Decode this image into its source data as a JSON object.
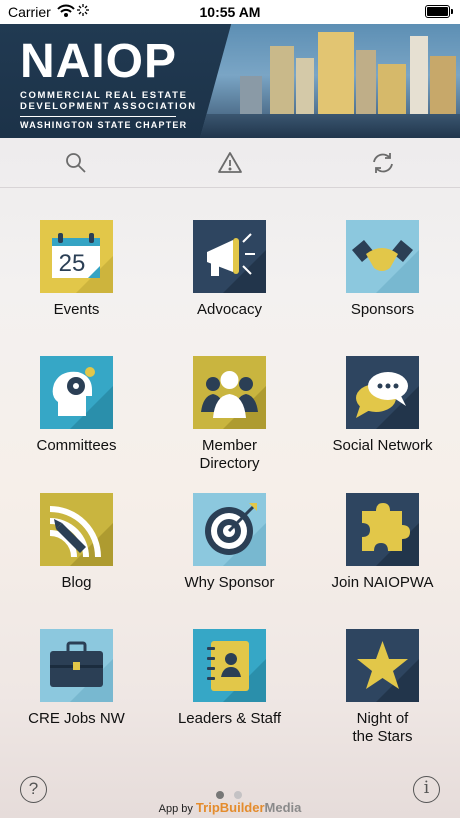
{
  "status": {
    "carrier": "Carrier",
    "time": "10:55 AM"
  },
  "header": {
    "logo_text": "NAIOP",
    "logo_sub_line1": "COMMERCIAL REAL ESTATE",
    "logo_sub_line2": "DEVELOPMENT ASSOCIATION",
    "logo_chapter": "WASHINGTON STATE CHAPTER"
  },
  "toolbar": {
    "icons": [
      "search-icon",
      "alert-triangle-icon",
      "refresh-icon"
    ]
  },
  "tiles": [
    {
      "label": "Events",
      "icon": "calendar-icon",
      "color": "#e2c749",
      "day": "25"
    },
    {
      "label": "Advocacy",
      "icon": "megaphone-icon",
      "color": "#2e4560"
    },
    {
      "label": "Sponsors",
      "icon": "handshake-icon",
      "color": "#8cc8de"
    },
    {
      "label": "Committees",
      "icon": "head-gears-icon",
      "color": "#36a7c6"
    },
    {
      "label": "Member\nDirectory",
      "icon": "people-icon",
      "color": "#c9b53f"
    },
    {
      "label": "Social Network",
      "icon": "chat-bubbles-icon",
      "color": "#2e4560"
    },
    {
      "label": "Blog",
      "icon": "rss-pen-icon",
      "color": "#c9b53f"
    },
    {
      "label": "Why Sponsor",
      "icon": "target-icon",
      "color": "#8cc8de"
    },
    {
      "label": "Join NAIOPWA",
      "icon": "puzzle-icon",
      "color": "#2e4560"
    },
    {
      "label": "CRE Jobs NW",
      "icon": "briefcase-icon",
      "color": "#8cc8de"
    },
    {
      "label": "Leaders & Staff",
      "icon": "address-book-icon",
      "color": "#36a7c6"
    },
    {
      "label": "Night of\nthe Stars",
      "icon": "star-icon",
      "color": "#2e4560"
    }
  ],
  "footer": {
    "help_glyph": "?",
    "info_glyph": "i",
    "page_count": 2,
    "current_page": 1,
    "credit_prefix": "App by",
    "credit_brand_a": "TripBuilder",
    "credit_brand_b": "Media"
  },
  "colors": {
    "brand_navy": "#1f3851",
    "brand_orange": "#e48c2d",
    "brand_gray": "#8a8a8a"
  }
}
